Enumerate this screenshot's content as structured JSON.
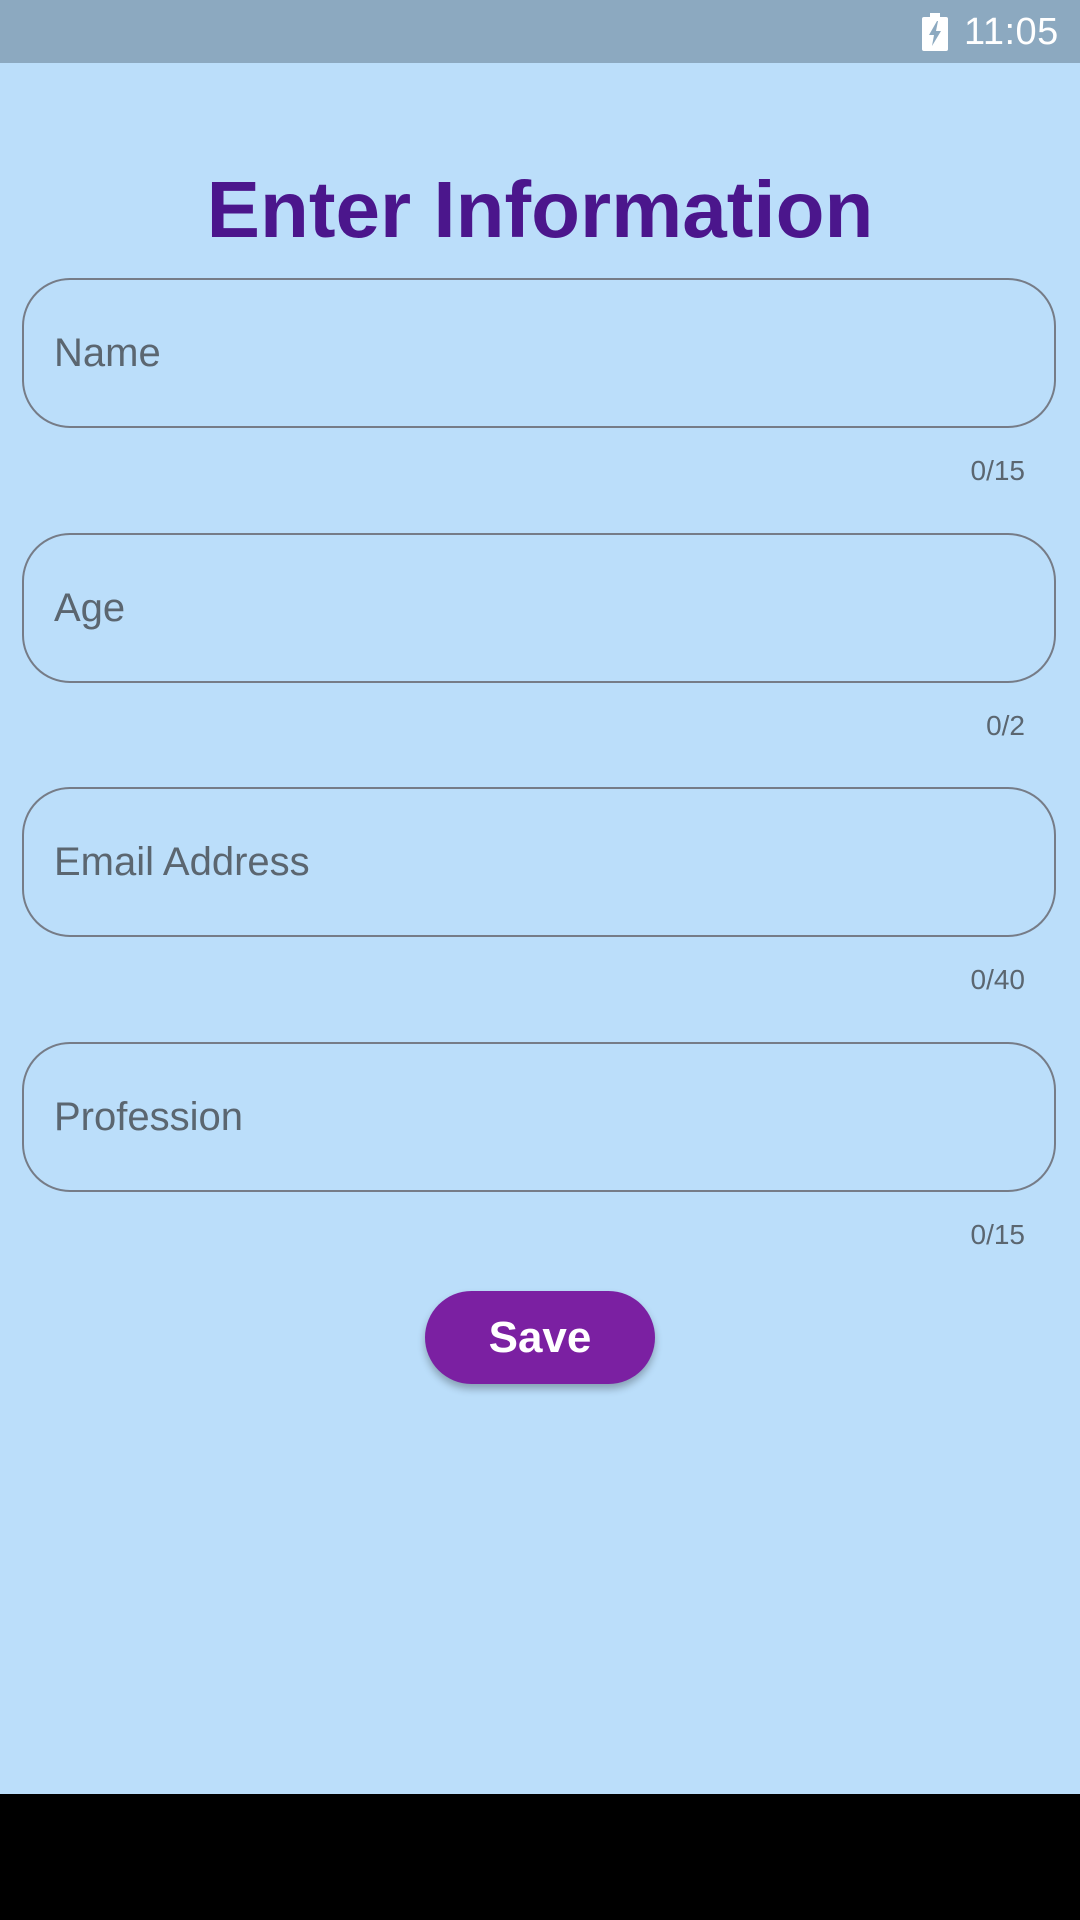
{
  "status_bar": {
    "time": "11:05",
    "battery_icon": "battery-charging-icon"
  },
  "page": {
    "title": "Enter Information",
    "title_color": "#4b168c",
    "background_color": "#bbdefa"
  },
  "form": {
    "fields": [
      {
        "placeholder": "Name",
        "value": "",
        "counter": "0/15",
        "max_length": 15
      },
      {
        "placeholder": "Age",
        "value": "",
        "counter": "0/2",
        "max_length": 2
      },
      {
        "placeholder": "Email Address",
        "value": "",
        "counter": "0/40",
        "max_length": 40
      },
      {
        "placeholder": "Profession",
        "value": "",
        "counter": "0/15",
        "max_length": 15
      }
    ],
    "save_label": "Save",
    "save_color": "#7b20a2"
  }
}
